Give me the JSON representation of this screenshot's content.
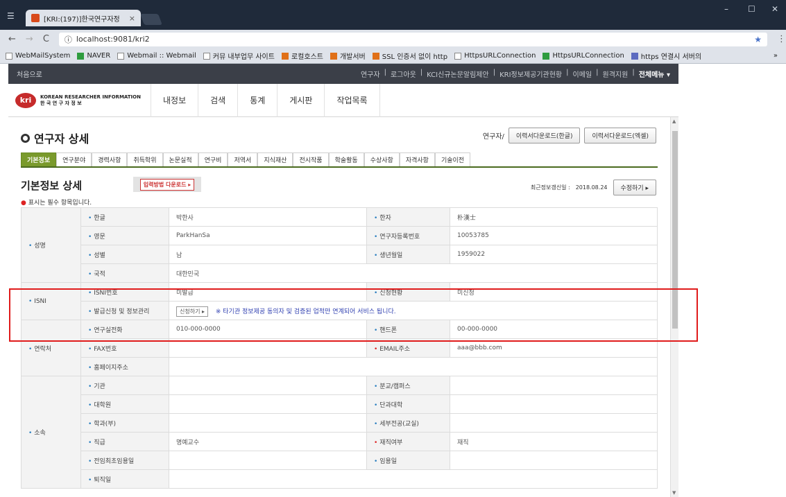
{
  "browser": {
    "tab_title": "[KRI:(197)]한국연구자정",
    "tab_close": "×",
    "address": "localhost:9081/kri2",
    "bookmarks": [
      "WebMailSystem",
      "NAVER",
      "Webmail :: Webmail",
      "커뮤 내부업무 사이트",
      "로컬호스트",
      "개발서버",
      "SSL 인증서 없이 http",
      "HttpsURLConnection",
      "HttpsURLConnection",
      "https 연결시 서버의"
    ],
    "bookmarks_more": "»",
    "win_min": "–",
    "win_max": "☐",
    "win_close": "✕"
  },
  "sitebar": {
    "left": "처음으로",
    "links": [
      "연구자",
      "로그아웃",
      "KCI신규논문알림제안",
      "KRI정보제공기관현황",
      "이메일",
      "원격지원"
    ],
    "all_menu": "전체메뉴 ▾"
  },
  "gnb": {
    "logo_mark": "kri",
    "logo_line1": "KOREAN RESEARCHER INFORMATION",
    "logo_line2": "한 국 연 구 자 정 보",
    "menu": [
      "내정보",
      "검색",
      "통계",
      "게시판",
      "작업목록"
    ]
  },
  "header": {
    "title": "연구자 상세",
    "role": "연구자/",
    "btn_ko": "이력서다운로드(한글)",
    "btn_en": "이력서다운로드(엑셀)"
  },
  "tabs": [
    "기본정보",
    "연구분야",
    "경력사항",
    "취득학위",
    "논문실적",
    "연구비",
    "저역서",
    "지식재산",
    "전시작품",
    "학술활동",
    "수상사항",
    "자격사항",
    "기술이전"
  ],
  "section": {
    "title": "기본정보 상세",
    "download_form": "입력방법 다운로드 ▸",
    "updated_label": "최근정보갱신일 :",
    "updated_date": "2018.08.24",
    "edit_btn": "수정하기 ▸",
    "required_note": "표시는 필수 항목입니다."
  },
  "rows": {
    "name_group": "성명",
    "hangul_label": "한글",
    "hangul_val": "박한사",
    "hanja_label": "한자",
    "hanja_val": "朴漢士",
    "english_label": "영문",
    "english_val": "ParkHanSa",
    "regno_label": "연구자등록번호",
    "regno_val": "10053785",
    "sex_label": "성별",
    "sex_val": "남",
    "birth_label": "생년월일",
    "birth_val": "1959022",
    "nation_label": "국적",
    "nation_val": "대한민국",
    "isni_group": "ISNI",
    "isni_label": "ISNI번호",
    "isni_val": "미발급",
    "apply_status_label": "신청현황",
    "apply_status_val": "미신청",
    "apply_label": "발급신청 및 정보관리",
    "apply_btn": "신청하기 ▸",
    "apply_notice": "※ 타기관 정보제공 동의자 및 검증된 업적만 연계되어 서비스 됩니다.",
    "contact_group": "연락처",
    "phone_label": "연구실전화",
    "phone_val": "010-000-0000",
    "mobile_label": "핸드폰",
    "mobile_val": "00-000-0000",
    "fax_label": "FAX번호",
    "fax_val": "",
    "email_label": "EMAIL주소",
    "email_val": "aaa@bbb.com",
    "homepage_label": "홈페이지주소",
    "org_group": "소속",
    "inst_label": "기관",
    "campus_label": "분교/캠퍼스",
    "grad_label": "대학원",
    "college_label": "단과대학",
    "dept_label": "학과(부)",
    "major_label": "세부전공(교실)",
    "rank_label": "직급",
    "rank_val": "명예교수",
    "status_label": "재직여부",
    "status_val": "재직",
    "first_hire_label": "전임최초임용일",
    "hire_label": "임용일",
    "retire_label": "퇴직일"
  }
}
